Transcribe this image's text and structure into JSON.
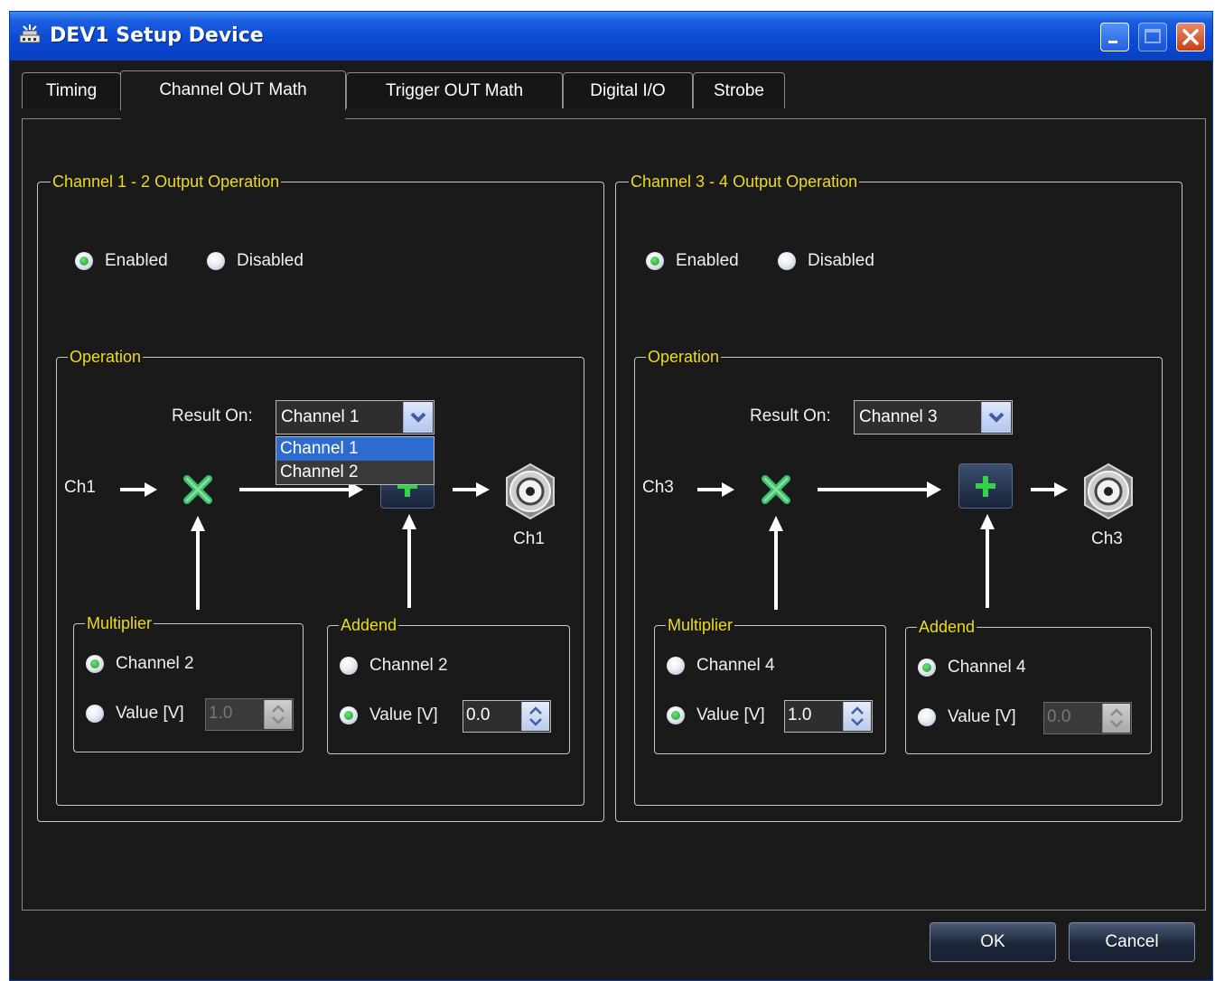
{
  "window": {
    "title": "DEV1 Setup Device"
  },
  "tabs": [
    "Timing",
    "Channel OUT Math",
    "Trigger OUT Math",
    "Digital I/O",
    "Strobe"
  ],
  "active_tab": "Channel OUT Math",
  "left": {
    "title": "Channel 1 - 2 Output Operation",
    "enabled_label": "Enabled",
    "disabled_label": "Disabled",
    "enabled": true,
    "operation_title": "Operation",
    "result_on_label": "Result On:",
    "result_on_value": "Channel 1",
    "dropdown_options": [
      "Channel 1",
      "Channel 2"
    ],
    "input_label": "Ch1",
    "output_label": "Ch1",
    "multiplier": {
      "title": "Multiplier",
      "channel_label": "Channel 2",
      "value_label": "Value [V]",
      "value": "1.0",
      "selected": "channel"
    },
    "addend": {
      "title": "Addend",
      "channel_label": "Channel 2",
      "value_label": "Value [V]",
      "value": "0.0",
      "selected": "value"
    }
  },
  "right": {
    "title": "Channel 3 - 4 Output Operation",
    "enabled_label": "Enabled",
    "disabled_label": "Disabled",
    "enabled": true,
    "operation_title": "Operation",
    "result_on_label": "Result On:",
    "result_on_value": "Channel 3",
    "input_label": "Ch3",
    "output_label": "Ch3",
    "multiplier": {
      "title": "Multiplier",
      "channel_label": "Channel 4",
      "value_label": "Value [V]",
      "value": "1.0",
      "selected": "value"
    },
    "addend": {
      "title": "Addend",
      "channel_label": "Channel 4",
      "value_label": "Value [V]",
      "value": "0.0",
      "selected": "channel"
    }
  },
  "buttons": {
    "ok": "OK",
    "cancel": "Cancel"
  },
  "colors": {
    "titlebar": "#0a4bd6",
    "legend": "#ecdc1a",
    "background": "#1a1a1a",
    "multiply_icon": "#3fbe6e",
    "plus_icon": "#32d24a"
  },
  "icons": [
    "device-icon",
    "minimize-icon",
    "maximize-icon",
    "close-icon",
    "multiply-icon",
    "plus-icon",
    "bnc-connector-icon",
    "arrow-right-icon",
    "arrow-up-icon",
    "chevron-down-icon",
    "spin-arrows-icon"
  ]
}
